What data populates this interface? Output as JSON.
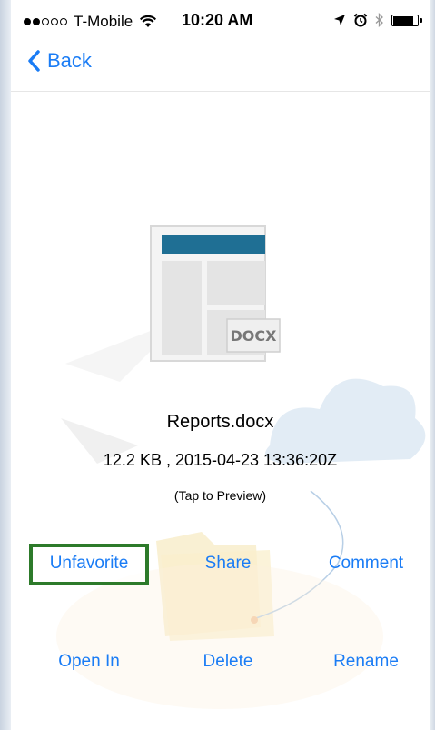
{
  "status_bar": {
    "carrier": "T-Mobile",
    "time": "10:20 AM",
    "signal_bars_filled": 2,
    "signal_bars_total": 5
  },
  "nav": {
    "back_label": "Back"
  },
  "file": {
    "badge": "DOCX",
    "name": "Reports.docx",
    "meta": "12.2 KB , 2015-04-23 13:36:20Z",
    "preview_hint": "(Tap to Preview)"
  },
  "actions": {
    "row1": [
      "Unfavorite",
      "Share",
      "Comment"
    ],
    "row2": [
      "Open In",
      "Delete",
      "Rename"
    ]
  },
  "colors": {
    "accent": "#1a7cf5",
    "highlight": "#2d7a2a",
    "doc_header": "#1f6f94"
  },
  "icons": [
    "wifi-icon",
    "location-arrow-icon",
    "alarm-icon",
    "bluetooth-icon",
    "battery-icon",
    "chevron-left-icon",
    "docx-file-icon"
  ]
}
